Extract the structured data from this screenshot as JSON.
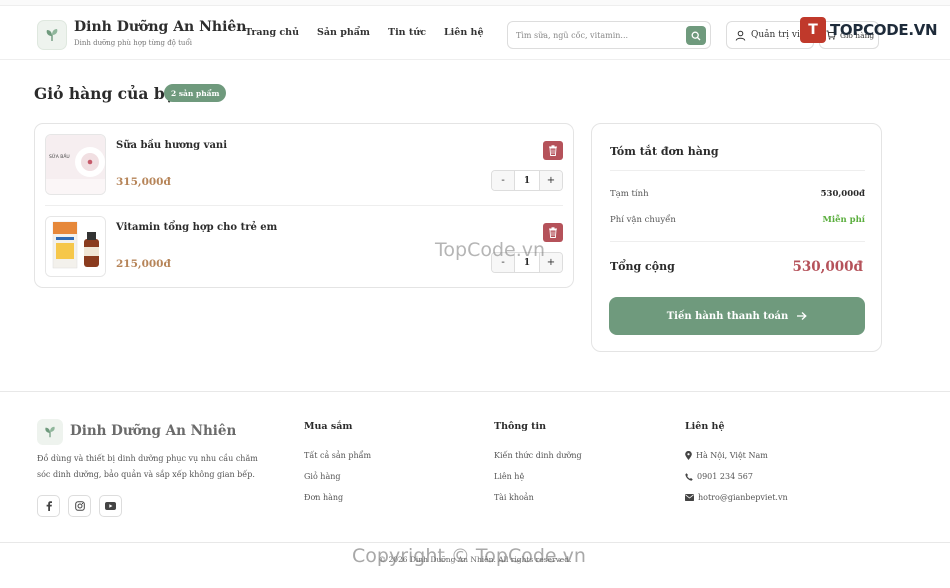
{
  "header": {
    "brand": "Dinh Dưỡng An Nhiên",
    "tagline": "Dinh dưỡng phù hợp từng độ tuổi",
    "nav": [
      "Trang chủ",
      "Sản phẩm",
      "Tin tức",
      "Liên hệ"
    ],
    "search_placeholder": "Tìm sữa, ngũ cốc, vitamin...",
    "admin_label": "Quản trị viên",
    "cart_label": "Giỏ hàng",
    "watermark_logo_text": "TOPCODE.VN"
  },
  "cart": {
    "title": "Giỏ hàng của bạn",
    "count_badge": "2 sản phẩm",
    "items": [
      {
        "name": "Sữa bầu hương vani",
        "price": "315,000đ",
        "quantity": "1",
        "thumb_text": "SỮA BẦU"
      },
      {
        "name": "Vitamin tổng hợp cho trẻ em",
        "price": "215,000đ",
        "quantity": "1"
      }
    ],
    "minus": "-",
    "plus": "+"
  },
  "summary": {
    "title": "Tóm tắt đơn hàng",
    "subtotal_label": "Tạm tính",
    "subtotal_value": "530,000đ",
    "shipping_label": "Phí vận chuyển",
    "shipping_value": "Miễn phí",
    "total_label": "Tổng cộng",
    "total_value": "530,000đ",
    "checkout_label": "Tiến hành thanh toán"
  },
  "footer": {
    "brand": "Dinh Dưỡng An Nhiên",
    "description": "Đồ dùng và thiết bị dinh dưỡng phục vụ nhu cầu chăm sóc dinh dưỡng, bảo quản và sắp xếp không gian bếp.",
    "columns": [
      {
        "heading": "Mua sắm",
        "links": [
          "Tất cả sản phẩm",
          "Giỏ hàng",
          "Đơn hàng"
        ]
      },
      {
        "heading": "Thông tin",
        "links": [
          "Kiến thức dinh dưỡng",
          "Liên hệ",
          "Tài khoản"
        ]
      },
      {
        "heading": "Liên hệ",
        "links": [
          "Hà Nội, Việt Nam",
          "0901 234 567",
          "hotro@gianbepviet.vn"
        ]
      }
    ],
    "copyright": "© 2026 Dinh Dưỡng An Nhiên. All rights reserved."
  },
  "watermarks": [
    "TopCode.vn",
    "Copyright © TopCode.vn"
  ],
  "colors": {
    "accent": "#6f9a7d",
    "price": "#b68458",
    "danger": "#b5525a",
    "free": "#5aae3d"
  }
}
